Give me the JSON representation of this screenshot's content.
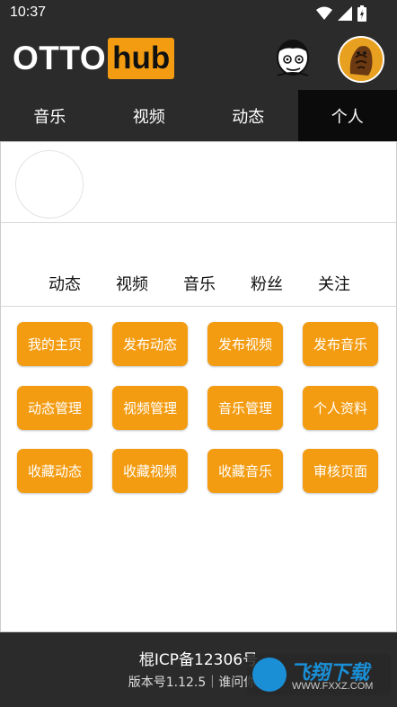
{
  "status_bar": {
    "time": "10:37",
    "icons": [
      "wifi-icon",
      "signal-icon",
      "battery-icon"
    ]
  },
  "app": {
    "logo_left": "OTTO",
    "logo_right": "hub",
    "accent_color": "#f39c12",
    "header_icons": [
      "user-sketch-avatar",
      "profile-avatar"
    ]
  },
  "tabs": [
    {
      "label": "音乐"
    },
    {
      "label": "视频"
    },
    {
      "label": "动态"
    },
    {
      "label": "个人",
      "active": true
    }
  ],
  "stats": [
    "动态",
    "视频",
    "音乐",
    "粉丝",
    "关注"
  ],
  "buttons": [
    "我的主页",
    "发布动态",
    "发布视频",
    "发布音乐",
    "动态管理",
    "视频管理",
    "音乐管理",
    "个人资料",
    "收藏动态",
    "收藏视频",
    "收藏音乐",
    "审核页面"
  ],
  "footer": {
    "icp": "棍ICP备12306号",
    "version": "版本号1.12.5｜谁问你了"
  },
  "watermark": {
    "title": "飞翔下载",
    "url": "WWW.FXXZ.COM"
  }
}
